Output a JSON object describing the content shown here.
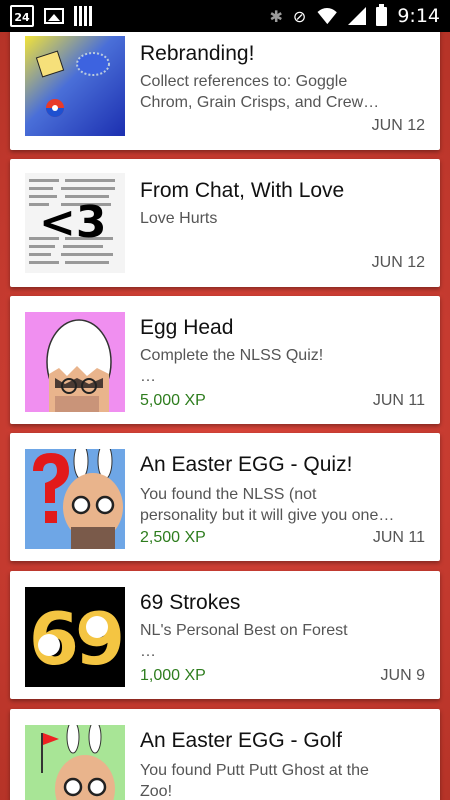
{
  "status_bar": {
    "calendar_day": "24",
    "time": "9:14",
    "icons": [
      "calendar-icon",
      "image-icon",
      "barcode-icon",
      "bluetooth-icon",
      "mute-icon",
      "wifi-icon",
      "signal-icon",
      "battery-icon"
    ]
  },
  "achievements": [
    {
      "title": "Rebranding!",
      "description": "Collect references to: Goggle\nChrom, Grain Crisps, and Crew…",
      "xp": "",
      "date": "JUN 12",
      "thumb_text": ""
    },
    {
      "title": "From Chat, With Love",
      "description": "Love Hurts",
      "xp": "",
      "date": "JUN 12",
      "thumb_text": "<3"
    },
    {
      "title": "Egg Head",
      "description": "Complete the NLSS Quiz!\n…",
      "xp": "5,000 XP",
      "date": "JUN 11",
      "thumb_text": ""
    },
    {
      "title": "An Easter EGG - Quiz!",
      "description": "You found the NLSS (not\npersonality but it will give you one…",
      "xp": "2,500 XP",
      "date": "JUN 11",
      "thumb_text": ""
    },
    {
      "title": "69 Strokes",
      "description": "NL's Personal Best on Forest\n…",
      "xp": "1,000 XP",
      "date": "JUN 9",
      "thumb_text": "69"
    },
    {
      "title": "An Easter EGG - Golf",
      "description": "You found Putt Putt Ghost at the\nZoo!",
      "xp": "",
      "date": "",
      "thumb_text": ""
    }
  ],
  "colors": {
    "background": "#c43a2f",
    "xp_green": "#2e7d1e",
    "card": "#ffffff"
  }
}
